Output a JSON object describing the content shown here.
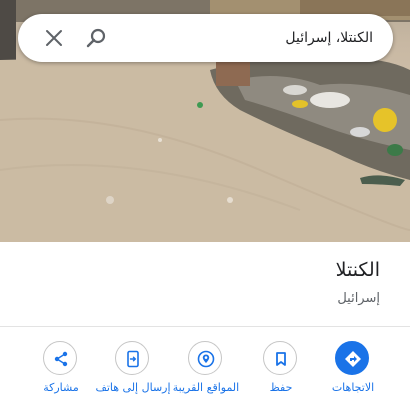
{
  "search": {
    "query": "الكنتلا، إسرائيل",
    "close_icon": "close-icon",
    "search_icon": "search-icon"
  },
  "place": {
    "title": "الكنتلا",
    "subtitle": "إسرائيل"
  },
  "actions": {
    "directions": {
      "label": "الاتجاهات",
      "icon": "directions-icon"
    },
    "save": {
      "label": "حفظ",
      "icon": "bookmark-icon"
    },
    "nearby": {
      "label": "المواقع القريبة",
      "icon": "nearby-icon"
    },
    "send_to_phone": {
      "label": "إرسال إلى هاتف",
      "icon": "phone-icon"
    },
    "share": {
      "label": "مشاركة",
      "icon": "share-icon"
    }
  },
  "colors": {
    "accent": "#1a73e8",
    "text_primary": "#202124",
    "text_secondary": "#5f6368"
  }
}
